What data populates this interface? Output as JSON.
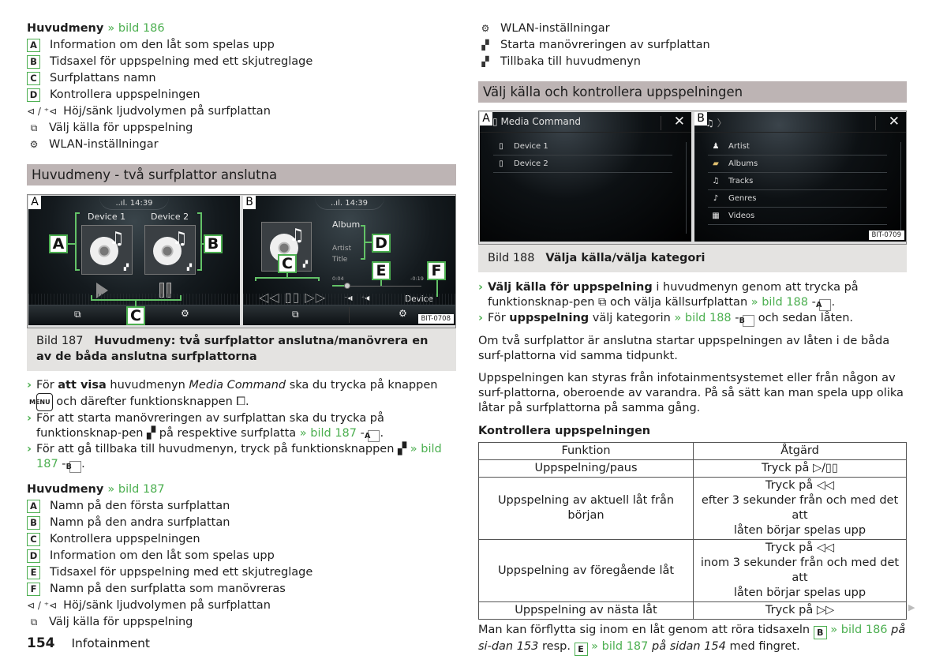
{
  "left": {
    "legend186": {
      "title": "Huvudmeny",
      "ref": "» bild 186",
      "items": [
        {
          "key": "A",
          "text": "Information om den låt som spelas upp"
        },
        {
          "key": "B",
          "text": "Tidsaxel för uppspelning med ett skjutreglage"
        },
        {
          "key": "C",
          "text": "Surfplattans namn"
        },
        {
          "key": "D",
          "text": "Kontrollera uppspelningen"
        }
      ],
      "symbols": [
        {
          "icon": "volume-down-up-icon",
          "glyph": "⊲ / ⁺⊲",
          "text": "Höj/sänk ljudvolymen på surfplattan"
        },
        {
          "icon": "source-select-icon",
          "glyph": "⧉",
          "text": "Välj källa för uppspelning"
        },
        {
          "icon": "wlan-settings-icon",
          "glyph": "⚙",
          "text": "WLAN-inställningar"
        }
      ]
    },
    "heading": "Huvudmeny - två surfplattor anslutna",
    "figure187": {
      "screenA": {
        "tag": "A",
        "clock": "14:39",
        "signal": "..ıl.",
        "device1": "Device 1",
        "device2": "Device 2",
        "callouts": {
          "a": "A",
          "b": "B",
          "c": "C"
        }
      },
      "screenB": {
        "tag": "B",
        "clock": "14:39",
        "signal": "..ıl.",
        "album": "Album",
        "artist": "Artist",
        "title": "Title",
        "time_elapsed": "0:04",
        "time_remaining": "-0:19",
        "progress_fraction": 0.17,
        "vol_down": "⁻◀",
        "vol_up": "⁺◀",
        "device": "Device",
        "controls": "◁◁ ▯▯ ▷▷",
        "callouts": {
          "c": "C",
          "d": "D",
          "e": "E",
          "f": "F"
        }
      },
      "code": "BIT-0708",
      "caption_num": "Bild 187",
      "caption_text": "Huvudmeny: två surfplattor anslutna/manövrera en av de båda anslutna surfplattorna"
    },
    "bullets": [
      {
        "pre": "För ",
        "bold": "att visa",
        "mid": " huvudmenyn ",
        "italic": "Media Command",
        "post": " ska du trycka på knappen ",
        "key": "MENU",
        "post2": " och därefter funktionsknappen ",
        "icon_glyph": "⧠",
        "end": "."
      },
      {
        "text": "För att starta manövreringen av surfplattan ska du trycka på funktionsknap-pen ",
        "icon_glyph": "▞",
        "mid": " på respektive surfplatta ",
        "ref": "» bild 187",
        "dash": " - ",
        "key": "A",
        "end": "."
      },
      {
        "text": "För att gå tillbaka till huvudmenyn, tryck på funktionsknappen ",
        "icon_glyph": "▞",
        "ref": " » bild 187",
        "dash": " - ",
        "key": "B",
        "end": "."
      }
    ],
    "legend187": {
      "title": "Huvudmeny",
      "ref": "» bild 187",
      "items": [
        {
          "key": "A",
          "text": "Namn på den första surfplattan"
        },
        {
          "key": "B",
          "text": "Namn på den andra surfplattan"
        },
        {
          "key": "C",
          "text": "Kontrollera uppspelningen"
        },
        {
          "key": "D",
          "text": "Information om den låt som spelas upp"
        },
        {
          "key": "E",
          "text": "Tidsaxel för uppspelning med ett skjutreglage"
        },
        {
          "key": "F",
          "text": "Namn på den surfplatta som manövreras"
        }
      ],
      "symbols": [
        {
          "icon": "volume-down-up-icon",
          "glyph": "⊲ / ⁺⊲",
          "text": "Höj/sänk ljudvolymen på surfplattan"
        },
        {
          "icon": "source-select-icon",
          "glyph": "⧉",
          "text": "Välj källa för uppspelning"
        }
      ]
    }
  },
  "right": {
    "symbols": [
      {
        "icon": "wlan-settings-icon",
        "glyph": "⚙",
        "text": "WLAN-inställningar"
      },
      {
        "icon": "tablet-control-icon",
        "glyph": "▞",
        "text": "Starta manövreringen av surfplattan"
      },
      {
        "icon": "tablet-control-icon",
        "glyph": "▞",
        "text": "Tillbaka till huvudmenyn"
      }
    ],
    "heading": "Välj källa och kontrollera uppspelningen",
    "figure188": {
      "screenA": {
        "tag": "A",
        "title": "Media Command",
        "rows": [
          "Device 1",
          "Device 2"
        ]
      },
      "screenB": {
        "tag": "B",
        "breadcrumb": "〉",
        "rows": [
          {
            "icon": "artist-icon",
            "glyph": "♟",
            "label": "Artist"
          },
          {
            "icon": "albums-icon",
            "glyph": "▰",
            "label": "Albums"
          },
          {
            "icon": "tracks-icon",
            "glyph": "♫",
            "label": "Tracks"
          },
          {
            "icon": "genres-icon",
            "glyph": "♪",
            "label": "Genres"
          },
          {
            "icon": "videos-icon",
            "glyph": "▦",
            "label": "Videos"
          }
        ]
      },
      "close_glyph": "✕",
      "code": "BIT-0709",
      "caption_num": "Bild 188",
      "caption_text": "Välja källa/välja kategori"
    },
    "bullets": [
      {
        "bold": "Välj källa för uppspelning",
        "text": " i huvudmenyn genom att trycka på funktionsknap-pen ",
        "icon_glyph": "⧉",
        "mid": " och välja källsurfplattan ",
        "ref": "» bild 188",
        "dash": " - ",
        "key": "A",
        "end": "."
      },
      {
        "pre": "För ",
        "bold": "uppspelning",
        "text": " välj kategorin ",
        "ref": "» bild 188",
        "dash": " - ",
        "key": "B",
        "end": " och sedan låten."
      }
    ],
    "para1": "Om två surfplattor är anslutna startar uppspelningen av låten i de båda surf-plattorna vid samma tidpunkt.",
    "para2": "Uppspelningen kan styras från infotainmentsystemet eller från någon av surf-plattorna, oberoende av varandra. På så sätt kan man spela upp olika låtar på surfplattorna på samma gång.",
    "table_title": "Kontrollera uppspelningen",
    "table": {
      "headers": [
        "Funktion",
        "Åtgärd"
      ],
      "rows": [
        {
          "func": "Uppspelning/paus",
          "action": [
            "Tryck på ▷/▯▯"
          ]
        },
        {
          "func": "Uppspelning av aktuell låt från början",
          "action": [
            "Tryck på ◁◁",
            "efter 3 sekunder från och med det att",
            "låten börjar spelas upp"
          ]
        },
        {
          "func": "Uppspelning av föregående låt",
          "action": [
            "Tryck på ◁◁",
            "inom 3 sekunder från och med det att",
            "låten börjar spelas upp"
          ]
        },
        {
          "func": "Uppspelning av nästa låt",
          "action": [
            "Tryck på ▷▷"
          ]
        }
      ]
    },
    "closing": {
      "text1": "Man kan förflytta sig inom en låt genom att röra tidsaxeln ",
      "key1": "B",
      "ref1": " » bild 186",
      "italic1": " på si-dan 153",
      "text2": " resp. ",
      "key2": "E",
      "ref2": " » bild 187",
      "italic2": " på sidan 154",
      "text3": " med fingret."
    },
    "next_glyph": "▶"
  },
  "footer": {
    "page": "154",
    "section": "Infotainment"
  },
  "colors": {
    "accent": "#4caf50",
    "heading_bar": "#bdb4b4",
    "caption_bg": "#e4e3e1"
  }
}
